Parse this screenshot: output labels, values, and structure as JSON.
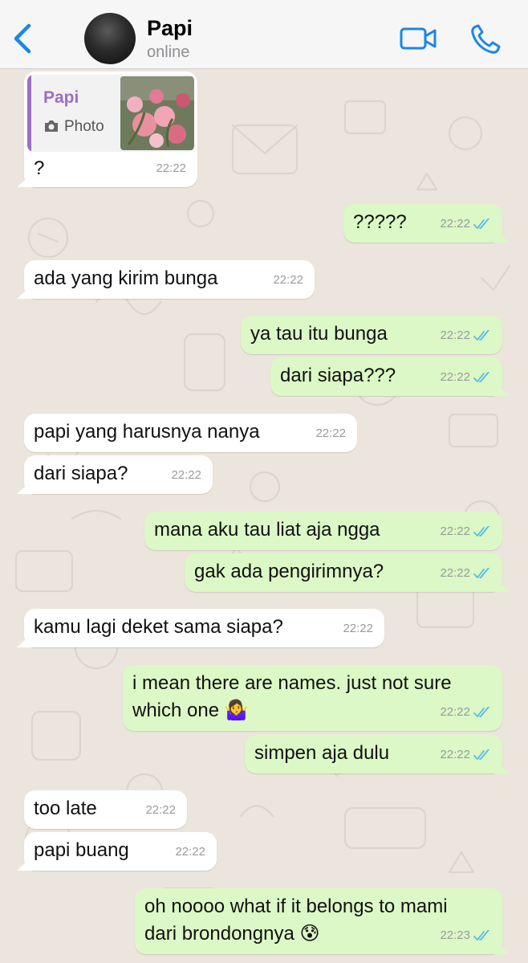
{
  "contact": {
    "name": "Papi",
    "status": "online"
  },
  "header": {
    "back_icon": "chevron-left-icon",
    "video_icon": "video-camera-icon",
    "call_icon": "phone-icon",
    "accent": "#1C86E6"
  },
  "colors": {
    "incoming": "#FFFFFF",
    "outgoing": "#DCF8C6",
    "background": "#ECE5DD",
    "read_ticks": "#53BDEB",
    "quote_accent": "#9C6FC6"
  },
  "messages": [
    {
      "dir": "in",
      "reply_to": "Papi",
      "reply_media": "Photo",
      "text": "?",
      "time": "22:22"
    },
    {
      "dir": "out",
      "text": "?????",
      "time": "22:22"
    },
    {
      "dir": "in",
      "text": "ada yang kirim bunga",
      "time": "22:22"
    },
    {
      "dir": "out",
      "text": "ya tau itu bunga",
      "time": "22:22"
    },
    {
      "dir": "out",
      "text": "dari siapa???",
      "time": "22:22"
    },
    {
      "dir": "in",
      "text": "papi yang harusnya nanya",
      "time": "22:22"
    },
    {
      "dir": "in",
      "text": "dari siapa?",
      "time": "22:22"
    },
    {
      "dir": "out",
      "text": "mana aku tau liat aja ngga",
      "time": "22:22"
    },
    {
      "dir": "out",
      "text": "gak ada pengirimnya?",
      "time": "22:22"
    },
    {
      "dir": "in",
      "text": "kamu lagi deket sama siapa?",
      "time": "22:22"
    },
    {
      "dir": "out",
      "text_line1": "i mean there are names. just not sure",
      "text_line2": "which one 🤷‍♀️",
      "time": "22:22"
    },
    {
      "dir": "out",
      "text": "simpen aja dulu",
      "time": "22:22"
    },
    {
      "dir": "in",
      "text": "too late",
      "time": "22:22"
    },
    {
      "dir": "in",
      "text": "papi buang",
      "time": "22:22"
    },
    {
      "dir": "out",
      "text_line1": "oh noooo what if it belongs to mami",
      "text_line2": "dari brondongnya 😰",
      "time": "22:23"
    }
  ]
}
